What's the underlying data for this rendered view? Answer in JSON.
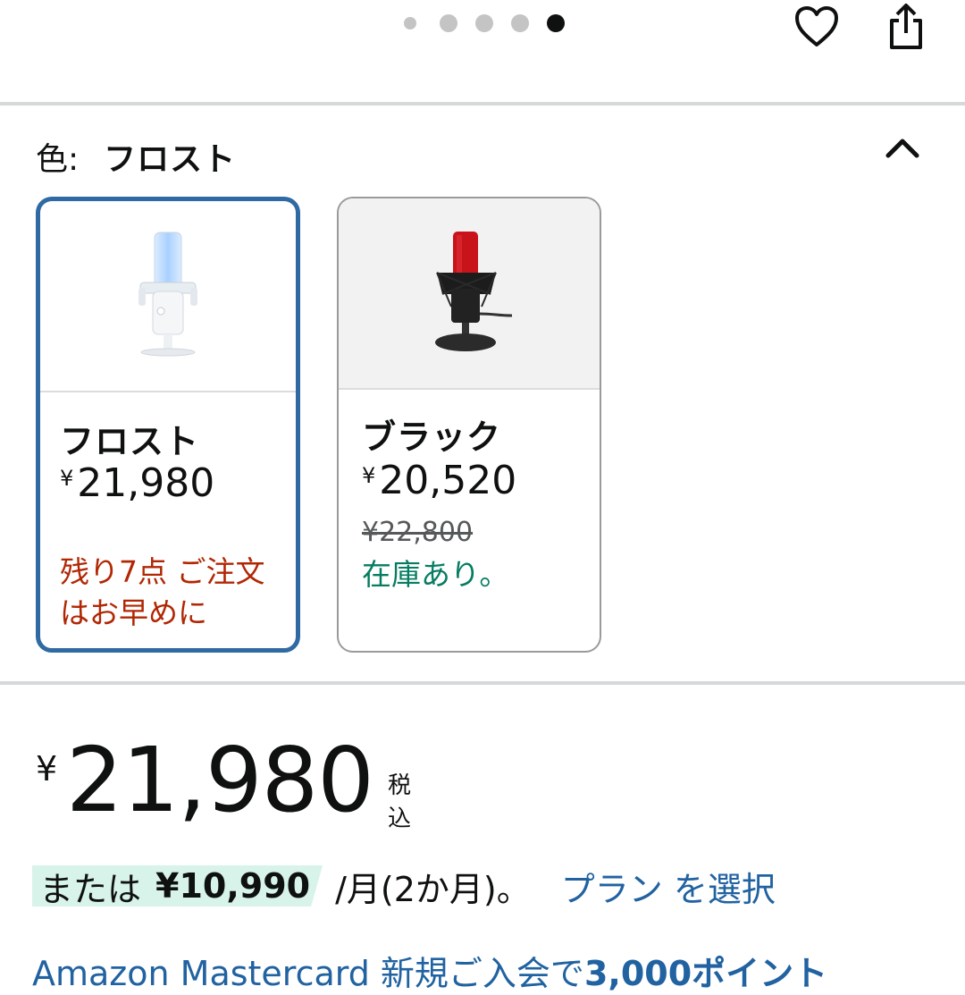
{
  "carousel": {
    "count": 5,
    "active_index": 4
  },
  "header": {
    "heart_icon": "heart-icon",
    "share_icon": "share-icon"
  },
  "color": {
    "label": "色:",
    "selected": "フロスト"
  },
  "swatches": [
    {
      "name": "フロスト",
      "currency": "¥",
      "price": "21,980",
      "list_price": "",
      "stock": "残り7点 ご注文はお早めに",
      "stock_status": "low",
      "selected": true
    },
    {
      "name": "ブラック",
      "currency": "¥",
      "price": "20,520",
      "list_price": "¥22,800",
      "stock": "在庫あり。",
      "stock_status": "in_stock",
      "selected": false
    }
  ],
  "price": {
    "currency": "¥",
    "amount": "21,980",
    "tax_note": "税込"
  },
  "installment": {
    "prefix": "または",
    "amount": "¥10,990",
    "period": "/月(2か月)。",
    "plan_link": "プラン を選択"
  },
  "promo": {
    "text": "Amazon Mastercard 新規ご入会で",
    "points": "3,000ポイント"
  },
  "colors": {
    "link": "#2162a1",
    "selected_border": "#2f6aa3",
    "low_stock": "#b12704",
    "in_stock": "#067d62",
    "installment_highlight": "#d7f3ea"
  }
}
